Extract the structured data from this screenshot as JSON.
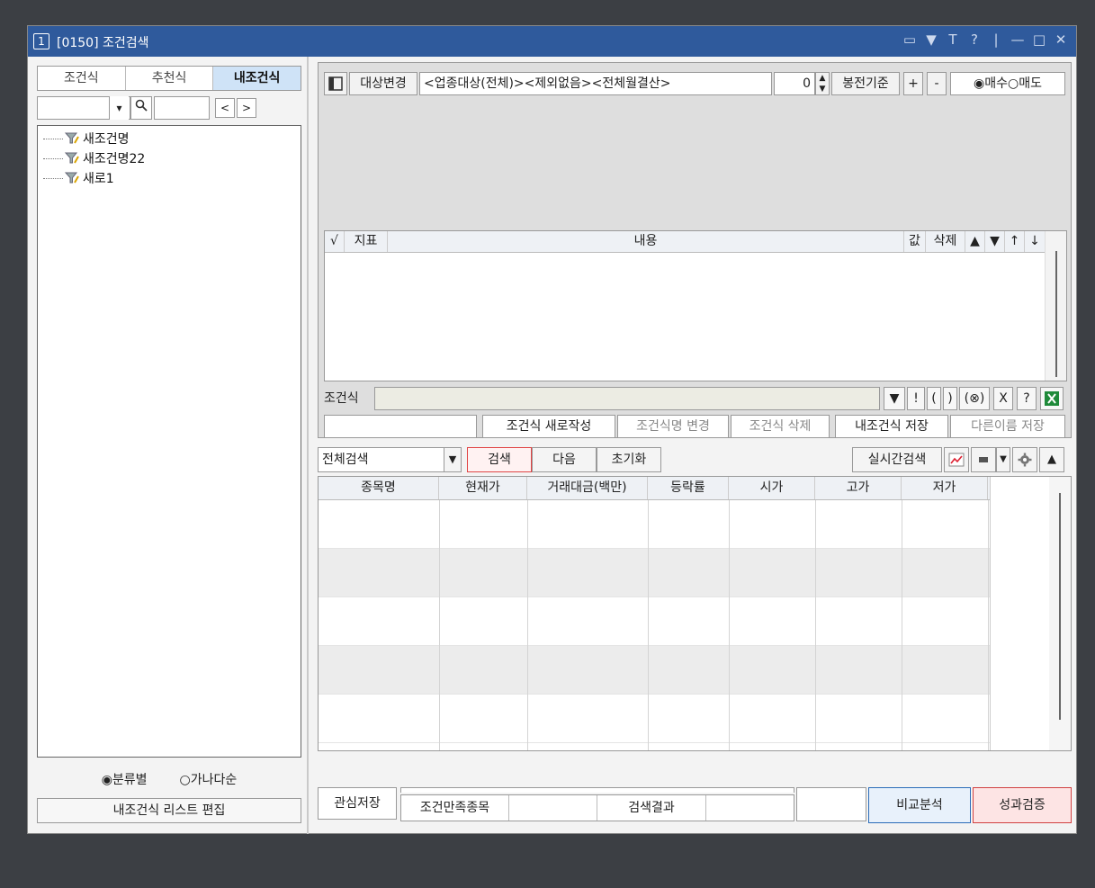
{
  "window": {
    "number": "1",
    "title": "[0150] 조건검색",
    "title_icons": [
      "▭",
      "▼",
      "T",
      "?",
      "|",
      "—",
      "□",
      "✕"
    ]
  },
  "left": {
    "tabs": [
      "조건식",
      "추천식",
      "내조건식"
    ],
    "search_dropdown_icon": "▾",
    "search_icon": "🔍",
    "prev": "<",
    "next": ">",
    "tree": [
      "새조건명",
      "새조건명22",
      "새로1"
    ],
    "radio": [
      "분류별",
      "가나다순"
    ],
    "edit_button": "내조건식 리스트 편집"
  },
  "top_toolbar": {
    "icon": "▣",
    "target_button": "대상변경",
    "target_text": "<업종대상(전체)><제외없음><전체월결산>",
    "count_value": "0",
    "candle_label": "봉전기준",
    "plus": "+",
    "minus": "-",
    "buy": "매수",
    "sell": "매도"
  },
  "cond_table": {
    "headers": [
      "√",
      "지표",
      "내용",
      "값",
      "삭제",
      "▲",
      "▼",
      "↑",
      "↓"
    ]
  },
  "expr": {
    "label": "조건식",
    "buttons": [
      "▼",
      "!",
      "(",
      ")",
      "(⊗)",
      "X",
      "?"
    ]
  },
  "save_row": {
    "new_button": "조건식 새로작성",
    "rename_button": "조건식명 변경",
    "delete_button": "조건식 삭제",
    "save_button": "내조건식 저장",
    "saveas_button": "다른이름 저장"
  },
  "search_row": {
    "select": "전체검색",
    "search": "검색",
    "next": "다음",
    "reset": "초기화",
    "realtime": "실시간검색"
  },
  "grid": {
    "headers": [
      "종목명",
      "현재가",
      "거래대금(백만)",
      "등락률",
      "시가",
      "고가",
      "저가"
    ]
  },
  "bottom": {
    "watch_save": "관심저장",
    "satisfied": "조건만족종목",
    "result": "검색결과",
    "compare": "비교분석",
    "verify": "성과검증"
  },
  "colors": {
    "titlebar": "#2f5a9c",
    "active_tab": "#cfe3f7",
    "search_button_border": "#e04444",
    "compare_border": "#2b6cb8",
    "verify_border": "#d04040"
  }
}
